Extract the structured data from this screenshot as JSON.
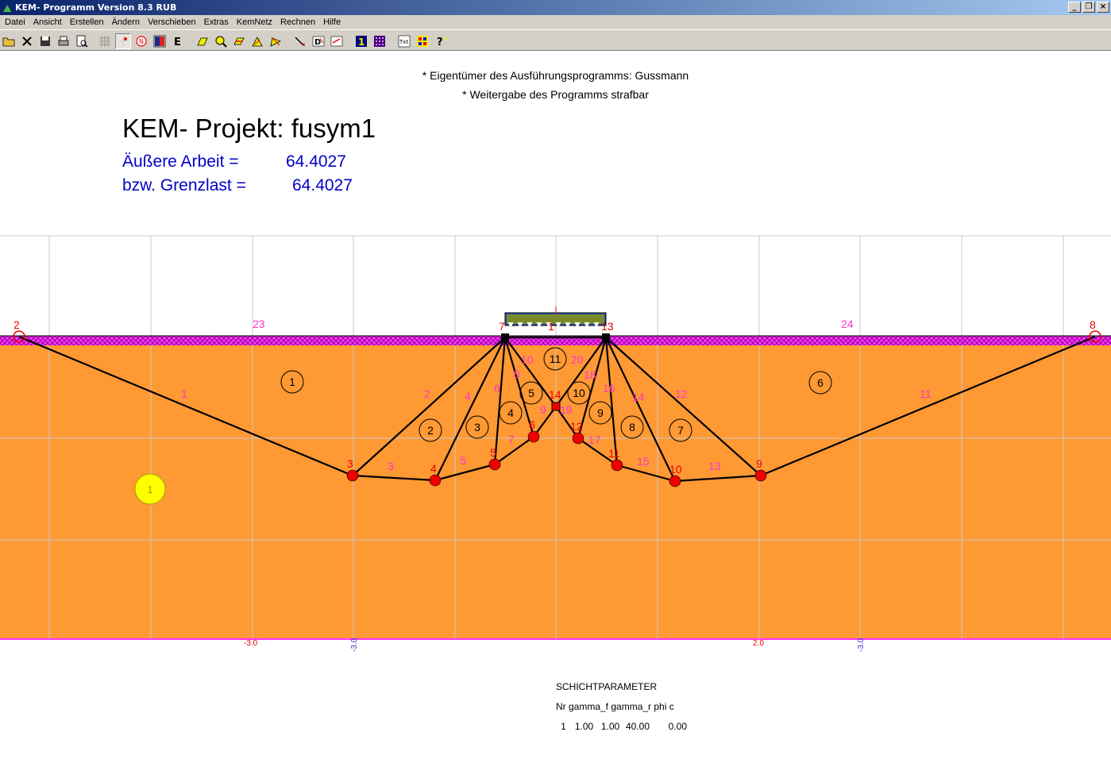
{
  "window": {
    "title": "KEM- Programm Version 8.3 RUB"
  },
  "menu": [
    "Datei",
    "Ansicht",
    "Erstellen",
    "Ändern",
    "Verschieben",
    "Extras",
    "KemNetz",
    "Rechnen",
    "Hilfe"
  ],
  "toolbar_icons": [
    "open-folder-icon",
    "close-x-icon",
    "save-icon",
    "print-icon",
    "print-preview-icon",
    "grid-icon",
    "point-icon",
    "node-n-icon",
    "color-icon",
    "e-icon",
    "edge-icon",
    "zoom-icon",
    "move-icon",
    "triangle-icon",
    "rotate-icon",
    "arrow-icon",
    "d-icon",
    "arrow2-icon",
    "one-icon",
    "matrix-icon",
    "text-icon",
    "dots-icon",
    "help-icon"
  ],
  "notes": {
    "owner": "* Eigentümer des Ausführungsprogramms: Gussmann",
    "forbidden": "* Weitergabe des Programms strafbar"
  },
  "project": {
    "title": "KEM- Projekt: fusym1"
  },
  "results": {
    "work_label": "Äußere Arbeit =",
    "work_value": "64.4027",
    "limit_label": "bzw. Grenzlast =",
    "limit_value": "64.4027"
  },
  "colors": {
    "soil": "#ff9933",
    "surface": "#ff33ff",
    "node": "#ff0000",
    "label": "#ff33cc",
    "result": "#0000c8"
  },
  "axis_labels": [
    {
      "text": "-3.0",
      "rotated": false
    },
    {
      "text": "-3.0",
      "rotated": true
    },
    {
      "text": "2.0",
      "rotated": false
    },
    {
      "text": "-3.0",
      "rotated": true
    }
  ],
  "layer_params": {
    "header": "SCHICHTPARAMETER",
    "columns": "Nr gamma_f gamma_r phi c",
    "rows": [
      {
        "nr": "1",
        "gamma_f": "1.00",
        "gamma_r": "1.00",
        "phi": "40.00",
        "c": "0.00"
      }
    ]
  },
  "mechanism": {
    "nodes": [
      {
        "id": "1",
        "kind": "load"
      },
      {
        "id": "2",
        "kind": "surface"
      },
      {
        "id": "3",
        "kind": "soil"
      },
      {
        "id": "4",
        "kind": "soil"
      },
      {
        "id": "5",
        "kind": "soil"
      },
      {
        "id": "6",
        "kind": "soil"
      },
      {
        "id": "7",
        "kind": "footing"
      },
      {
        "id": "8",
        "kind": "surface"
      },
      {
        "id": "9",
        "kind": "soil"
      },
      {
        "id": "10",
        "kind": "soil"
      },
      {
        "id": "11",
        "kind": "soil"
      },
      {
        "id": "12",
        "kind": "soil"
      },
      {
        "id": "13",
        "kind": "footing"
      },
      {
        "id": "14",
        "kind": "center"
      }
    ],
    "edges": [
      "1",
      "2",
      "3",
      "4",
      "5",
      "6",
      "7",
      "8",
      "9",
      "10",
      "11",
      "12",
      "13",
      "14",
      "15",
      "16",
      "17",
      "18",
      "19",
      "20",
      "23",
      "24"
    ],
    "bodies": [
      "1",
      "2",
      "3",
      "4",
      "5",
      "6",
      "7",
      "8",
      "9",
      "10",
      "11"
    ],
    "layer_marker": "1"
  }
}
